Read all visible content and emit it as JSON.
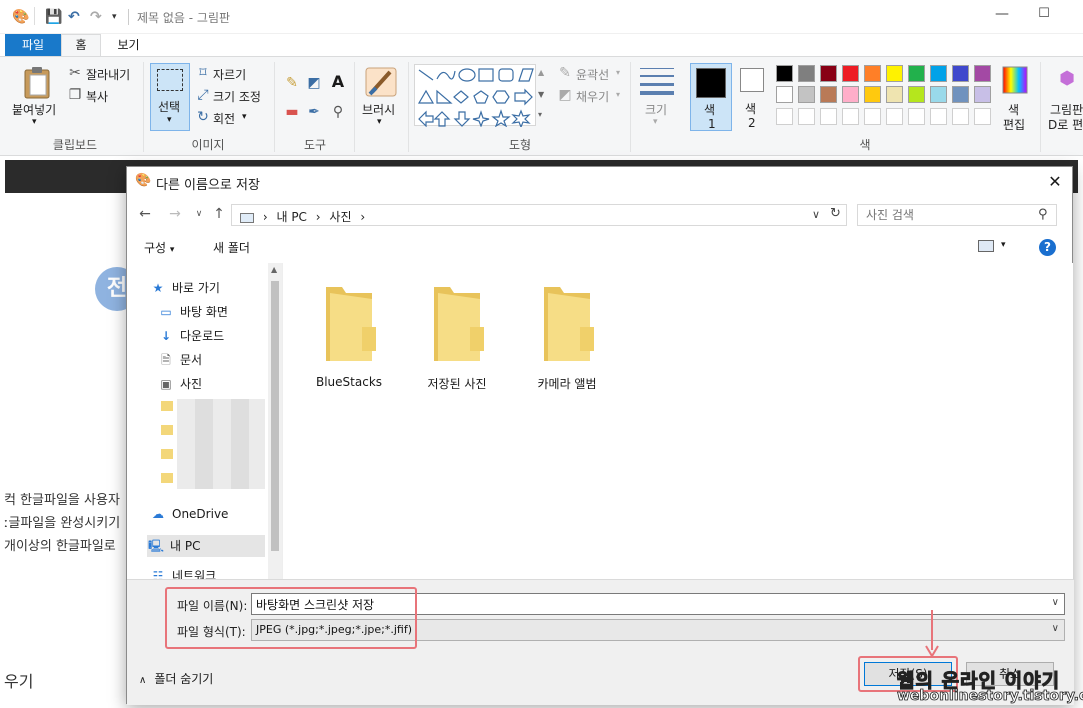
{
  "window": {
    "title": "제목 없음 - 그림판",
    "minimize_icon": "minimize-icon",
    "maximize_icon": "maximize-icon"
  },
  "ribbon_tabs": [
    "파일",
    "홈",
    "보기"
  ],
  "ribbon": {
    "clipboard": {
      "paste": "붙여넣기",
      "cut": "잘라내기",
      "copy": "복사",
      "group": "클립보드"
    },
    "image": {
      "select": "선택",
      "crop": "자르기",
      "resize": "크기 조정",
      "rotate": "회전",
      "group": "이미지"
    },
    "tools": {
      "group": "도구"
    },
    "brushes": {
      "label": "브러시"
    },
    "shapes": {
      "outline": "윤곽선",
      "fill": "채우기",
      "group": "도형"
    },
    "size": {
      "label": "크기"
    },
    "color1": {
      "label": "색",
      "num": "1",
      "value": "#000000"
    },
    "color2": {
      "label": "색",
      "num": "2",
      "value": "#ffffff"
    },
    "colors_group": "색",
    "edit_colors": {
      "l1": "색",
      "l2": "편집"
    },
    "paint3d": {
      "l1": "그림판",
      "l2": "D로 편"
    },
    "palette_row1": [
      "#000000",
      "#7f7f7f",
      "#880015",
      "#ed1c24",
      "#ff7f27",
      "#fff200",
      "#22b14c",
      "#00a2e8",
      "#3f48cc",
      "#a349a4"
    ],
    "palette_row2": [
      "#ffffff",
      "#c3c3c3",
      "#b97a57",
      "#ffaec9",
      "#ffc90e",
      "#efe4b0",
      "#b5e61d",
      "#99d9ea",
      "#7092be",
      "#c8bfe7"
    ]
  },
  "background_page": {
    "avatar_char": "전",
    "line1": "컥 한글파일을 사용자",
    "line2": "ː글파일을 완성시키기",
    "line3": "개이상의 한글파일로",
    "bottom": "우기"
  },
  "dialog": {
    "title": "다른 이름으로 저장",
    "address": [
      "내 PC",
      "사진"
    ],
    "search_placeholder": "사진 검색",
    "organize": "구성",
    "new_folder": "새 폴더",
    "help": "?",
    "nav": {
      "quick_access": "바로 가기",
      "desktop": "바탕 화면",
      "downloads": "다운로드",
      "documents": "문서",
      "pictures": "사진",
      "onedrive": "OneDrive",
      "this_pc": "내 PC",
      "network": "네트워크"
    },
    "folders": [
      "BlueStacks",
      "저장된 사진",
      "카메라 앨범"
    ],
    "filename_label": "파일 이름(N):",
    "filename_value": "바탕화면 스크린샷 저장",
    "filetype_label": "파일 형식(T):",
    "filetype_value": "JPEG (*.jpg;*.jpeg;*.jpe;*.jfif)",
    "hide_folders": "폴더 숨기기",
    "save": "저장(S)",
    "cancel": "취소"
  },
  "watermark": {
    "line1": "웹의 온라인 이야기",
    "line2": "webonlinestory.tistory.com"
  },
  "colors": {
    "accent": "#1979ca",
    "highlight_box": "#e8747a",
    "folder": "#f3d77a"
  }
}
